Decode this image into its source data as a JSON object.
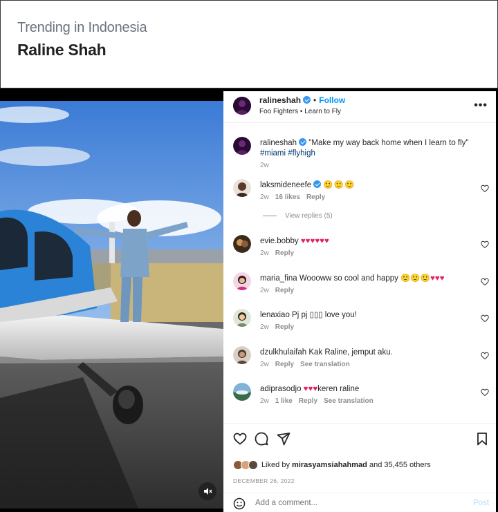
{
  "trend": {
    "label": "Trending in Indonesia",
    "title": "Raline Shah"
  },
  "post": {
    "username": "ralineshah",
    "separator": "•",
    "follow_label": "Follow",
    "audio": "Foo Fighters • Learn to Fly",
    "more_label": "•••",
    "caption": {
      "username": "ralineshah",
      "text": "\"Make my way back home when I learn to fly\"",
      "tags": "#miami #flyhigh",
      "time": "2w"
    },
    "comments": [
      {
        "username": "laksmideneefe",
        "verified": true,
        "text": "",
        "emoji": "🙂🙂🙂",
        "time": "2w",
        "likes": "16 likes",
        "reply": "Reply",
        "view_replies": "View replies (5)"
      },
      {
        "username": "evie.bobby",
        "text": "",
        "emoji": "♥♥♥♥♥♥",
        "time": "2w",
        "reply": "Reply"
      },
      {
        "username": "maria_fina",
        "text": "Woooww so cool and happy",
        "emoji": "🙂🙂🙂♥♥♥",
        "time": "2w",
        "reply": "Reply"
      },
      {
        "username": "lenaxiao",
        "text": "Pj pj ▯▯▯ love you!",
        "time": "2w",
        "reply": "Reply"
      },
      {
        "username": "dzulkhulaifah",
        "text": "Kak Raline, jemput aku.",
        "time": "2w",
        "reply": "Reply",
        "translate": "See translation"
      },
      {
        "username": "adiprasodjo",
        "text": "keren raline",
        "emoji": "♥♥♥",
        "time": "2w",
        "likes": "1 like",
        "reply": "Reply",
        "translate": "See translation"
      }
    ],
    "liked_by_prefix": "Liked by",
    "liked_by_user": "mirasyamsiahahmad",
    "liked_by_suffix": "and 35,455 others",
    "date": "DECEMBER 26, 2022",
    "add_comment_placeholder": "Add a comment...",
    "post_label": "Post"
  },
  "icons": {
    "heart": "heart-icon",
    "comment": "comment-icon",
    "share": "share-icon",
    "save": "bookmark-icon",
    "mute": "mute-icon",
    "emoji": "emoji-icon"
  },
  "colors": {
    "link_blue": "#0095f6",
    "verified_blue": "#3897f0",
    "heart_red": "#e0245e",
    "tag_blue": "#00376b"
  }
}
